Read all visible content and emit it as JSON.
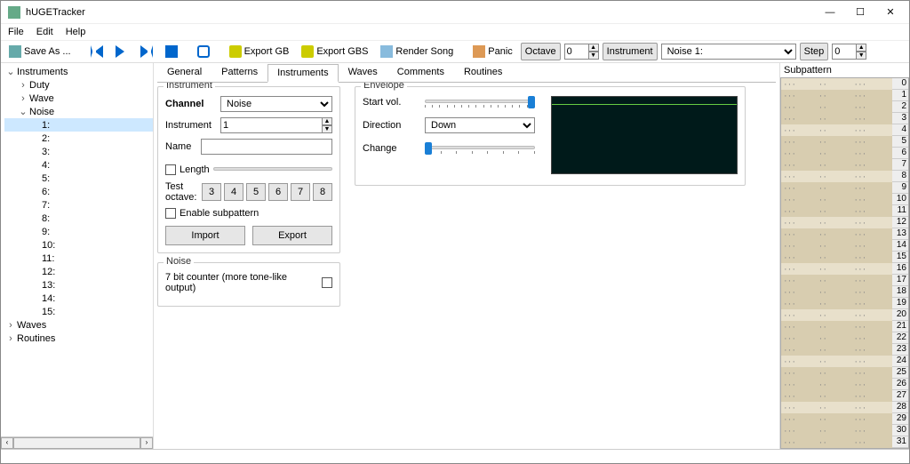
{
  "window": {
    "title": "hUGETracker"
  },
  "menu": [
    "File",
    "Edit",
    "Help"
  ],
  "toolbar": {
    "save": "Save As ...",
    "exportgb": "Export GB",
    "exportgbs": "Export GBS",
    "render": "Render Song",
    "panic": "Panic",
    "octave_lbl": "Octave",
    "octave_val": "0",
    "instr_lbl": "Instrument",
    "instr_val": "Noise 1:",
    "step_lbl": "Step",
    "step_val": "0"
  },
  "tree": {
    "root": "Instruments",
    "groups": [
      "Duty",
      "Wave",
      "Noise"
    ],
    "noise_items": [
      "1:",
      "2:",
      "3:",
      "4:",
      "5:",
      "6:",
      "7:",
      "8:",
      "9:",
      "10:",
      "11:",
      "12:",
      "13:",
      "14:",
      "15:"
    ],
    "others": [
      "Waves",
      "Routines"
    ]
  },
  "tabs": [
    "General",
    "Patterns",
    "Instruments",
    "Waves",
    "Comments",
    "Routines"
  ],
  "instr_grp": {
    "legend": "Instrument",
    "channel_lbl": "Channel",
    "channel_val": "Noise",
    "instrument_lbl": "Instrument",
    "instrument_val": "1",
    "name_lbl": "Name",
    "name_val": "",
    "length_lbl": "Length",
    "testoct_lbl": "Test octave:",
    "testoct_vals": [
      "3",
      "4",
      "5",
      "6",
      "7",
      "8"
    ],
    "enable_sub": "Enable subpattern",
    "import": "Import",
    "export": "Export"
  },
  "noise_grp": {
    "legend": "Noise",
    "sevenbit": "7 bit counter (more tone-like output)"
  },
  "env": {
    "legend": "Envelope",
    "startvol": "Start vol.",
    "direction_lbl": "Direction",
    "direction_val": "Down",
    "change": "Change"
  },
  "subpat": {
    "head": "Subpattern",
    "rows": 32
  }
}
